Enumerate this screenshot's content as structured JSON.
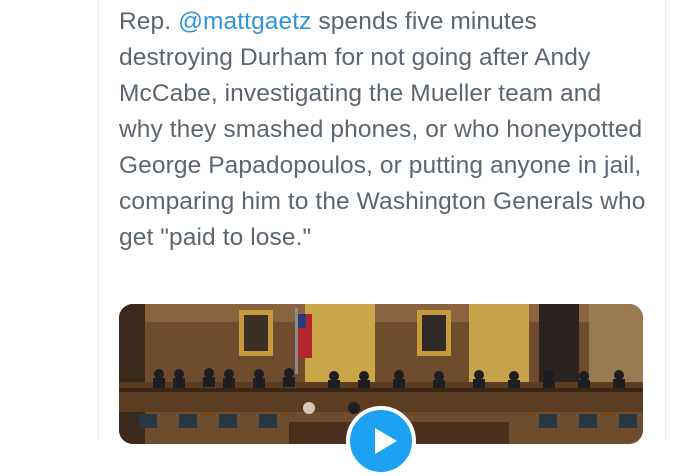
{
  "tweet": {
    "prefix": "Rep. ",
    "mention": "@mattgaetz",
    "body": " spends five minutes destroying Durham for not going after Andy McCabe, investigating the Mueller team and why they smashed phones, or who honeypotted George Papadopoulos, or putting anyone in jail, comparing him to the Washington Generals who get \"paid to lose.\""
  },
  "media": {
    "type": "video",
    "play_icon": "play-icon",
    "accent": "#1da1f2"
  }
}
